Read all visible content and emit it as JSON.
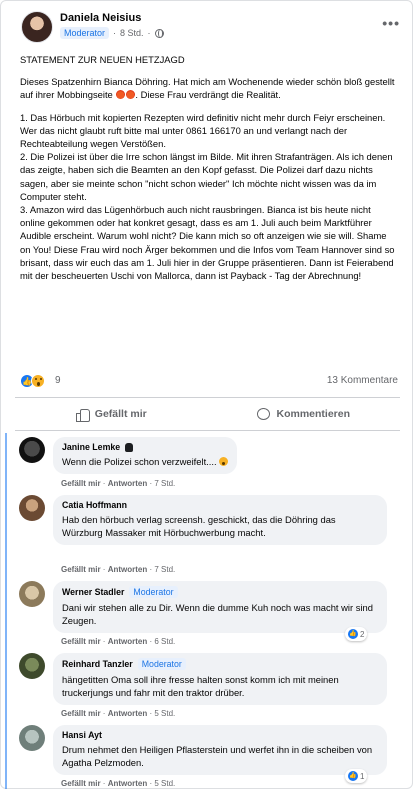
{
  "post": {
    "author": "Daniela Neisius",
    "badge": "Moderator",
    "time": "8 Std.",
    "more": "•••",
    "title": "STATEMENT ZUR NEUEN HETZJAGD",
    "para1": "Dieses Spatzenhirn Bianca Döhring. Hat mich am Wochenende wieder schön bloß gestellt auf ihrer Mobbingseite",
    "para1_end": ". Diese Frau verdrängt die Realität.",
    "para2": "1. Das Hörbuch mit kopierten Rezepten wird definitiv nicht mehr durch Feiyr erscheinen. Wer das nicht glaubt ruft bitte mal unter 0861 166170 an und verlangt nach der Rechteabteilung wegen Verstößen.",
    "para3": "2. Die Polizei ist über die Irre schon längst im Bilde. Mit ihren Strafanträgen. Als ich denen das zeigte, haben sich die Beamten an den Kopf gefasst. Die Polizei darf dazu nichts sagen, aber sie meinte schon \"nicht schon wieder\" Ich möchte nicht wissen was da im Computer steht.",
    "para4": "3. Amazon wird das Lügenhörbuch auch nicht rausbringen. Bianca ist bis heute nicht online gekommen oder hat konkret gesagt, dass es am 1. Juli auch beim Marktführer Audible erscheint. Warum wohl nicht? Die kann mich so oft anzeigen wie sie will. Shame on You! Diese Frau wird noch Ärger bekommen und die Infos vom Team Hannover sind so brisant, dass wir euch das am 1. Juli hier in der Gruppe präsentieren. Dann ist Feierabend mit der bescheuerten Uschi von Mallorca, dann ist Payback - Tag der Abrechnung!",
    "reactions_count": "9",
    "comments_count": "13 Kommentare",
    "like_label": "Gefällt mir",
    "comment_label": "Kommentieren"
  },
  "comments": [
    {
      "name": "Janine Lemke",
      "text": "Wenn die Polizei schon verzweifelt....",
      "like": "Gefällt mir",
      "reply": "Antworten",
      "time": "7 Std."
    },
    {
      "name": "Catia Hoffmann",
      "text": "Hab den hörbuch verlag screensh. geschickt, das die Döhring das Würzburg Massaker mit Hörbuchwerbung macht.",
      "like": "Gefällt mir",
      "reply": "Antworten",
      "time": "7 Std."
    },
    {
      "name": "Werner Stadler",
      "badge": "Moderator",
      "text": "Dani wir stehen alle zu Dir. Wenn die dumme Kuh noch was macht wir sind Zeugen.",
      "like": "Gefällt mir",
      "reply": "Antworten",
      "time": "6 Std.",
      "reactions": "2"
    },
    {
      "name": "Reinhard Tanzler",
      "badge": "Moderator",
      "text": "hängetitten Oma soll ihre fresse halten sonst komm ich mit meinen truckerjungs und fahr mit den traktor drüber.",
      "like": "Gefällt mir",
      "reply": "Antworten",
      "time": "5 Std."
    },
    {
      "name": "Hansi Ayt",
      "text": "Drum nehmet den Heiligen Pflasterstein und werfet ihn in die scheiben von Agatha Pelzmoden.",
      "like": "Gefällt mir",
      "reply": "Antworten",
      "time": "5 Std.",
      "reactions": "1"
    }
  ],
  "colors": {
    "accent": "#1877f2",
    "bubble": "#f0f2f5",
    "muted": "#65676b"
  }
}
